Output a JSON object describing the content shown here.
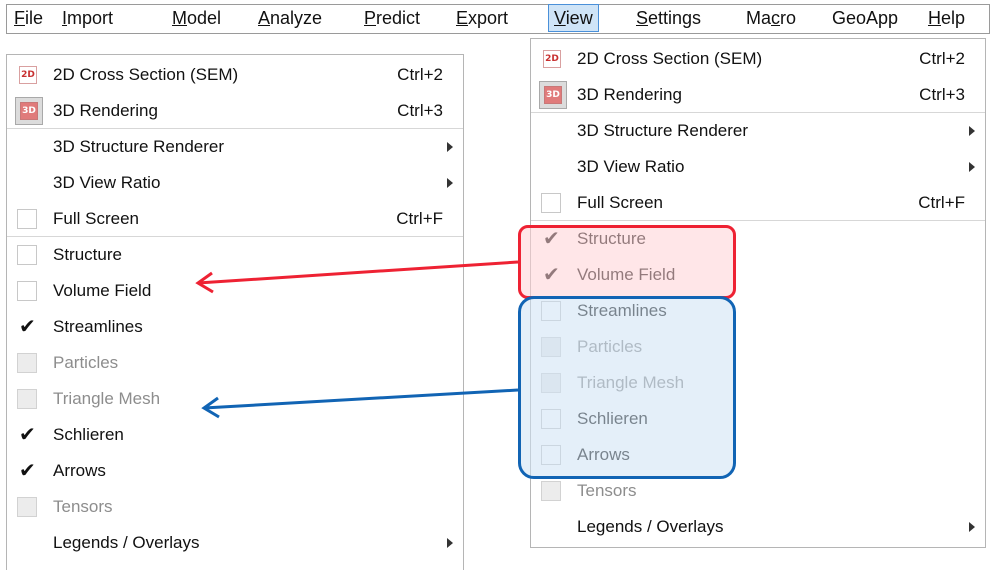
{
  "menubar": {
    "items": [
      "File",
      "Import",
      "Model",
      "Analyze",
      "Predict",
      "Export",
      "View",
      "Settings",
      "Macro",
      "GeoApp",
      "Help"
    ],
    "active": "View"
  },
  "left_menu": {
    "items": [
      {
        "label": "2D Cross Section (SEM)",
        "shortcut": "Ctrl+2",
        "icon": "2d-icon",
        "icon_text": "2D"
      },
      {
        "label": "3D Rendering",
        "shortcut": "Ctrl+3",
        "icon": "3d-icon",
        "icon_text": "3D"
      },
      {
        "label": "3D Structure Renderer",
        "submenu": true
      },
      {
        "label": "3D View Ratio",
        "submenu": true
      },
      {
        "label": "Full Screen",
        "shortcut": "Ctrl+F",
        "checkbox": true,
        "checked": false
      },
      {
        "label": "Structure",
        "checkbox": true,
        "checked": false
      },
      {
        "label": "Volume Field",
        "checkbox": true,
        "checked": false
      },
      {
        "label": "Streamlines",
        "checkbox": true,
        "checked": true
      },
      {
        "label": "Particles",
        "checkbox": true,
        "checked": false,
        "disabled": true
      },
      {
        "label": "Triangle Mesh",
        "checkbox": true,
        "checked": false,
        "disabled": true
      },
      {
        "label": "Schlieren",
        "checkbox": true,
        "checked": true
      },
      {
        "label": "Arrows",
        "checkbox": true,
        "checked": true
      },
      {
        "label": "Tensors",
        "checkbox": true,
        "checked": false,
        "disabled": true
      },
      {
        "label": "Legends / Overlays",
        "submenu": true
      }
    ]
  },
  "right_menu": {
    "items": [
      {
        "label": "2D Cross Section (SEM)",
        "shortcut": "Ctrl+2",
        "icon": "2d-icon",
        "icon_text": "2D"
      },
      {
        "label": "3D Rendering",
        "shortcut": "Ctrl+3",
        "icon": "3d-icon",
        "icon_text": "3D"
      },
      {
        "label": "3D Structure Renderer",
        "submenu": true
      },
      {
        "label": "3D View Ratio",
        "submenu": true
      },
      {
        "label": "Full Screen",
        "shortcut": "Ctrl+F",
        "checkbox": true,
        "checked": false
      },
      {
        "label": "Structure",
        "checkbox": true,
        "checked": true
      },
      {
        "label": "Volume Field",
        "checkbox": true,
        "checked": true
      },
      {
        "label": "Streamlines",
        "checkbox": true,
        "checked": false
      },
      {
        "label": "Particles",
        "checkbox": true,
        "checked": false,
        "disabled": true
      },
      {
        "label": "Triangle Mesh",
        "checkbox": true,
        "checked": false,
        "disabled": true
      },
      {
        "label": "Schlieren",
        "checkbox": true,
        "checked": false
      },
      {
        "label": "Arrows",
        "checkbox": true,
        "checked": false
      },
      {
        "label": "Tensors",
        "checkbox": true,
        "checked": false,
        "disabled": true
      },
      {
        "label": "Legends / Overlays",
        "submenu": true
      }
    ]
  },
  "colors": {
    "highlight_red": "#ee2233",
    "highlight_blue": "#1164b4"
  }
}
